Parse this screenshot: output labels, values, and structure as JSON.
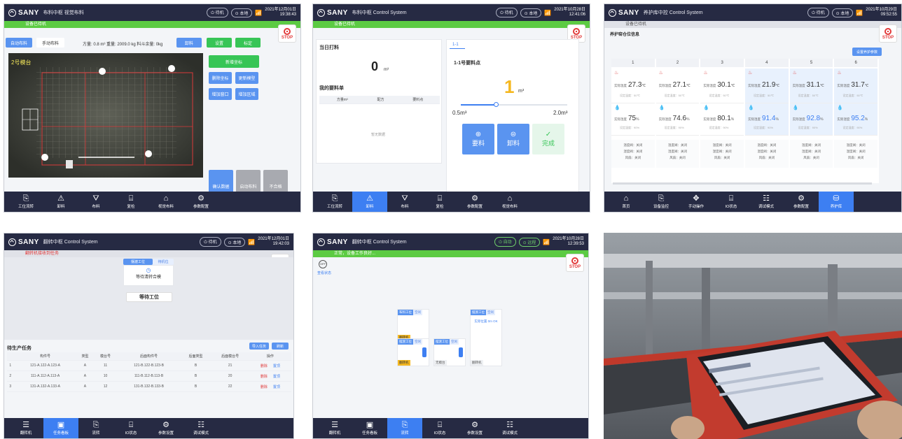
{
  "common": {
    "brand": "SANY",
    "stop_label": "STOP"
  },
  "p1": {
    "title": "布料中枢  视觉布料",
    "mode1": "待机",
    "mode2": "本地",
    "clock_date": "2021年12月01日",
    "clock_time": "19:38:43",
    "status": "设备已待机",
    "tab_auto": "自动布料",
    "tab_manual": "手动布料",
    "info": "方量: 0.8 m³  重量: 2009.0 kg  料斗余量: 0kg",
    "btn_unload": "卸料",
    "btn_settings": "设置",
    "btn_calibrate": "标定",
    "platform_label": "2号模台",
    "btn_add_coord": "新增坐标",
    "btn_del_coord": "删除坐标",
    "btn_update_model": "更新模型",
    "btn_window": "增加窗口",
    "btn_area": "增加区域",
    "btn_confirm": "确认数据",
    "btn_start": "启动布料",
    "btn_reject": "不合格",
    "nav": [
      "工位流转",
      "卸料",
      "布料",
      "复检",
      "视觉布料",
      "参数配置"
    ]
  },
  "p2": {
    "title": "布料中枢  Control System",
    "mode1": "待机",
    "mode2": "本地",
    "clock_date": "2021年10月28日",
    "clock_time": "12:41:06",
    "status": "设备已待机",
    "today_title": "当日打料",
    "today_value": "0",
    "today_unit": "m³",
    "my_orders": "我的要料单",
    "cols": [
      "方量m³",
      "配方",
      "要料点"
    ],
    "empty": "暂无数据",
    "tab_name": "1-1",
    "point_title": "1-1号要料点",
    "qty_value": "1",
    "qty_unit": "m³",
    "slider_min": "0.5m³",
    "slider_max": "2.0m³",
    "slider_level": 0.33,
    "btn_request": "要料",
    "btn_unload": "卸料",
    "btn_done": "完成",
    "nav": [
      "工位流转",
      "卸料",
      "布料",
      "复检",
      "参数配置",
      "视觉布料"
    ]
  },
  "p3": {
    "title": "养护库中控  Control System",
    "mode1": "待机",
    "mode2": "本地",
    "clock_date": "2021年10月29日",
    "clock_time": "09:52:55",
    "status": "设备已待机",
    "section": "养护窑仓位信息",
    "btn_set": "设置养护参数",
    "cols": [
      {
        "no": "1",
        "temp": "27.3",
        "hum": "75"
      },
      {
        "no": "2",
        "temp": "27.1",
        "hum": "74.6"
      },
      {
        "no": "3",
        "temp": "30.1",
        "hum": "80.1"
      },
      {
        "no": "4",
        "temp": "21.9",
        "hum": "91.4"
      },
      {
        "no": "5",
        "temp": "31.1",
        "hum": "92.8"
      },
      {
        "no": "6",
        "temp": "31.7",
        "hum": "95.2"
      }
    ],
    "temp_unit": "℃",
    "hum_unit": "%",
    "temp_label": "实际温度",
    "hum_label": "实际湿度",
    "temp_set": "设定温度：50℃",
    "hum_set": "设定湿度：90%",
    "row_a": "温度阀：关闭",
    "row_b": "湿度阀：关闭",
    "row_c": "风扇：关闭",
    "nav": [
      "首页",
      "设备监控",
      "手动操作",
      "IO状态",
      "调试模式",
      "参数配置",
      "养护库"
    ]
  },
  "p4": {
    "title": "翻转中枢  Control System",
    "mode1": "待机",
    "mode2": "本地",
    "clock_date": "2021年12月01日",
    "clock_time": "19:42:03",
    "status": "翻转机接收到任务",
    "tab_a": "摆渡工位",
    "tab_b": "待机位",
    "waiting": "等待清转合模",
    "wait_station": "等待工位",
    "task_title": "待生产任务",
    "btn_import": "导入任务",
    "btn_refresh": "刷新",
    "cols": [
      "",
      "构件号",
      "类型",
      "模台号",
      "后面构件号",
      "后面类型",
      "后面模台号",
      "操作"
    ],
    "rows": [
      [
        "1",
        "121-A.122-A.123-A",
        "A",
        "11",
        "121-B.122-B.123-B",
        "B",
        "21",
        "删除",
        "置顶"
      ],
      [
        "2",
        "111-A.112-A.113-A",
        "A",
        "10",
        "111-B.112-B.113-B",
        "B",
        "20",
        "删除",
        "置顶"
      ],
      [
        "3",
        "131-A.132-A.133-A",
        "A",
        "12",
        "131-B.132-B.133-B",
        "B",
        "22",
        "删除",
        "置顶"
      ]
    ],
    "nav": [
      "翻转机",
      "任务看板",
      "流转",
      "IO状态",
      "参数设置",
      "调试模式"
    ]
  },
  "p5": {
    "title": "翻转中枢  Control System",
    "mode1": "自动",
    "mode2": "远程",
    "clock_date": "2021年10月28日",
    "clock_time": "12:39:53",
    "status": "正常，设备工作良好...",
    "side_label": "查看状态",
    "boxes": [
      {
        "a": "布料工位",
        "b": "空闲",
        "foot": "翻转机"
      },
      {
        "a": "摆渡工位",
        "b": "空闲",
        "foot": "翻转机"
      },
      {
        "a": "摆渡工位",
        "b": "空闲",
        "foot": "无模台"
      },
      {
        "a": "摆渡工位",
        "b": "空闲",
        "foot": "翻转机"
      }
    ],
    "box_line": "实际位置 0m OK",
    "nav": [
      "翻转机",
      "任务看板",
      "流转",
      "IO状态",
      "参数设置",
      "调试模式"
    ]
  },
  "colors": {
    "topbar": "#262a43",
    "accent": "#3d7ff2",
    "green": "#37c556",
    "stop": "#e23b3b",
    "yellow": "#f5b821"
  }
}
